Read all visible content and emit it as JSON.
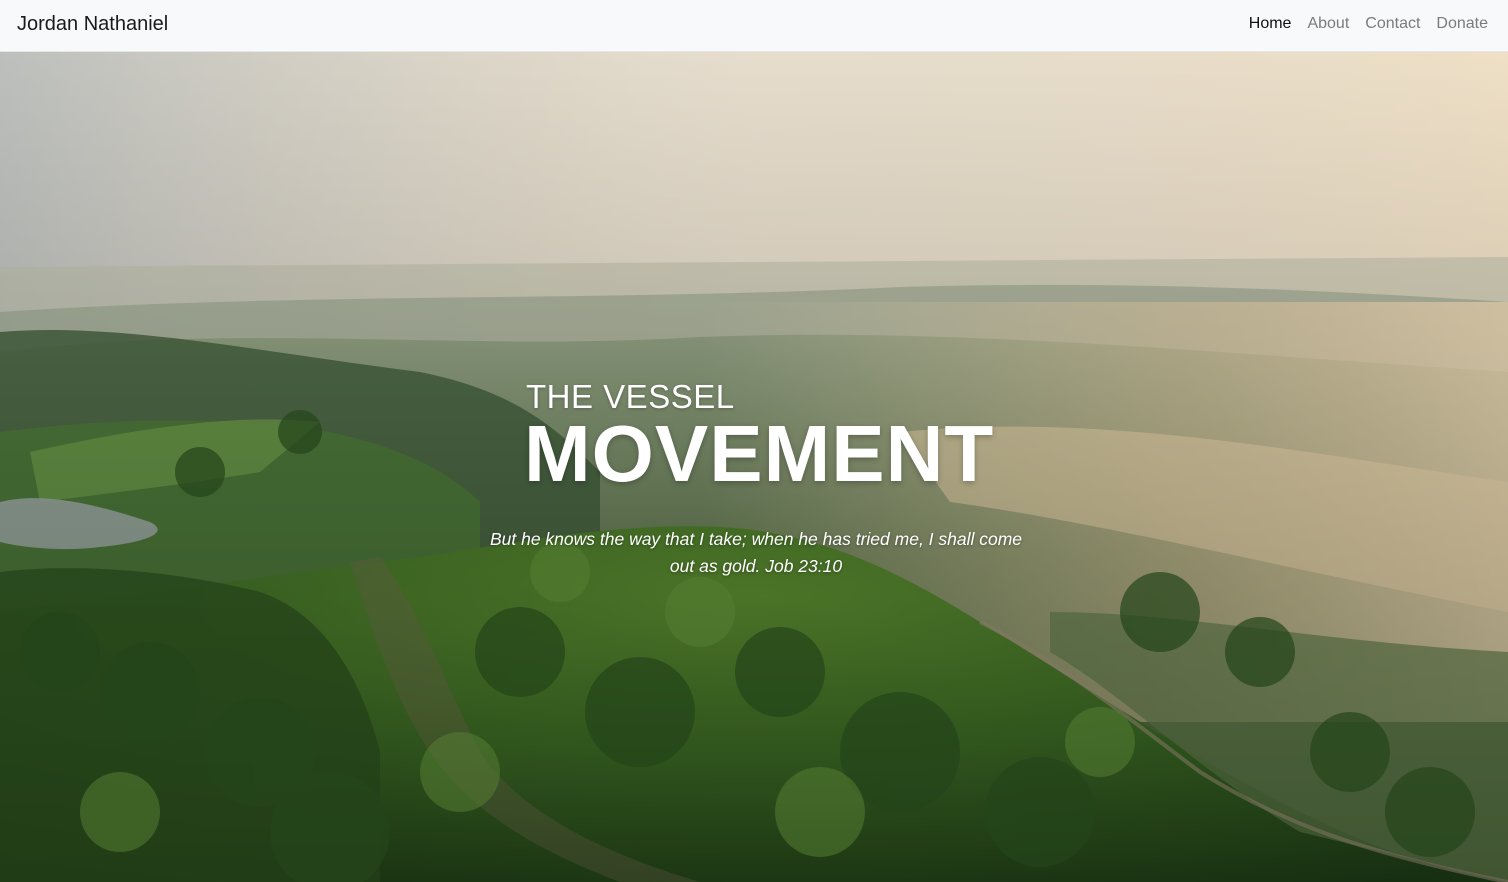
{
  "nav": {
    "brand": "Jordan Nathaniel",
    "links": [
      {
        "label": "Home",
        "active": true
      },
      {
        "label": "About",
        "active": false
      },
      {
        "label": "Contact",
        "active": false
      },
      {
        "label": "Donate",
        "active": false
      }
    ]
  },
  "hero": {
    "eyebrow": "THE VESSEL",
    "headline": "MOVEMENT",
    "verse": "But he knows the way that I take; when he has tried me, I shall come out as gold. Job 23:10",
    "background_description_colors": {
      "sky": "#efe6d6",
      "haze": "#d8c6a8",
      "forest": "#3f6b2e",
      "forest_dark": "#23401c"
    }
  }
}
